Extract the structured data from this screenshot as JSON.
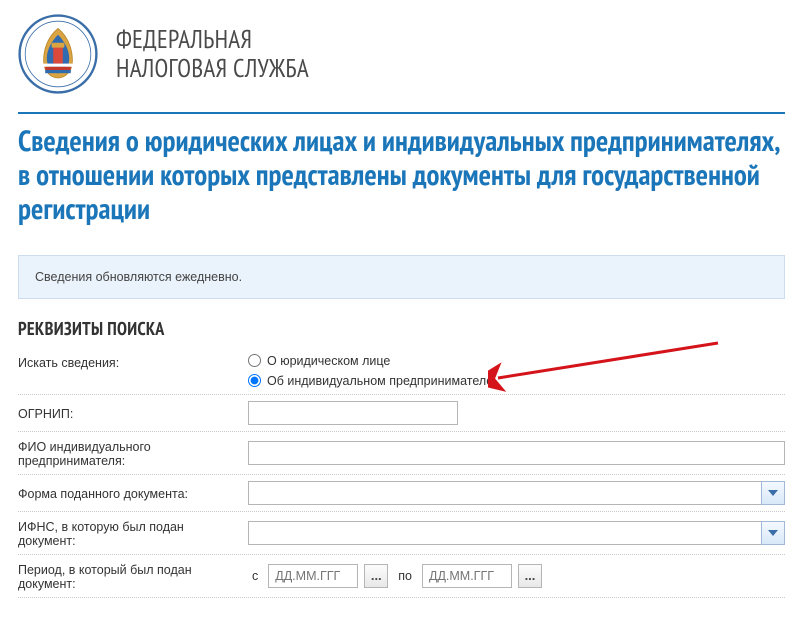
{
  "header": {
    "org_line1": "ФЕДЕРАЛЬНАЯ",
    "org_line2": "НАЛОГОВАЯ СЛУЖБА"
  },
  "page_title": "Сведения о юридических лицах и индивидуальных предпринимателях, в отношении которых представлены документы для государственной регистрации",
  "notice": "Сведения обновляются ежедневно.",
  "search": {
    "section_heading": "РЕКВИЗИТЫ ПОИСКА",
    "search_label": "Искать сведения:",
    "radio_legal": "О юридическом лице",
    "radio_ip": "Об индивидуальном предпринимателе",
    "ogrnip_label": "ОГРНИП:",
    "fio_label": "ФИО индивидуального предпринимателя:",
    "doc_form_label": "Форма поданного документа:",
    "ifns_label": "ИФНС, в которую был подан документ:",
    "period_label": "Период, в который был подан документ:",
    "period_from": "с",
    "period_to": "по",
    "date_placeholder": "ДД.ММ.ГГГ",
    "date_btn_label": "..."
  }
}
